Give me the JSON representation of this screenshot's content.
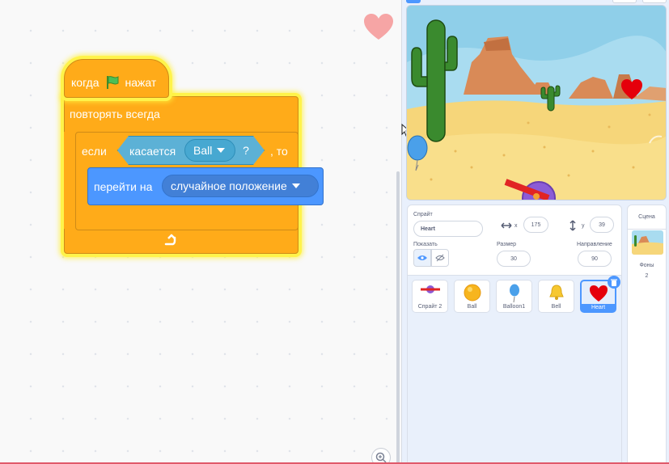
{
  "script": {
    "hat_when": "когда",
    "hat_clicked": "нажат",
    "forever_label": "повторять всегда",
    "if_label": "если",
    "then_label": ", то",
    "touching_label": "касается",
    "touching_target": "Ball",
    "question_mark": "?",
    "goto_label": "перейти на",
    "goto_target": "случайное положение"
  },
  "sprite_info": {
    "sprite_label": "Спрайт",
    "sprite_name": "Heart",
    "x_label": "x",
    "x_value": "175",
    "y_label": "y",
    "y_value": "39",
    "show_label": "Показать",
    "size_label": "Размер",
    "size_value": "30",
    "direction_label": "Направление",
    "direction_value": "90"
  },
  "sprites": [
    {
      "name": "Спрайт 2",
      "icon": "sprite2-icon"
    },
    {
      "name": "Ball",
      "icon": "ball-icon"
    },
    {
      "name": "Balloon1",
      "icon": "balloon-icon"
    },
    {
      "name": "Bell",
      "icon": "bell-icon"
    },
    {
      "name": "Heart",
      "icon": "heart-icon",
      "selected": true
    }
  ],
  "stage_panel": {
    "title": "Сцена",
    "backdrops_label": "Фоны",
    "backdrops_count": "2"
  },
  "colors": {
    "events": "#ffab19",
    "sensing": "#5cb1d6",
    "motion": "#4c97ff",
    "selected": "#4c97ff",
    "heart": "#e5000b"
  }
}
